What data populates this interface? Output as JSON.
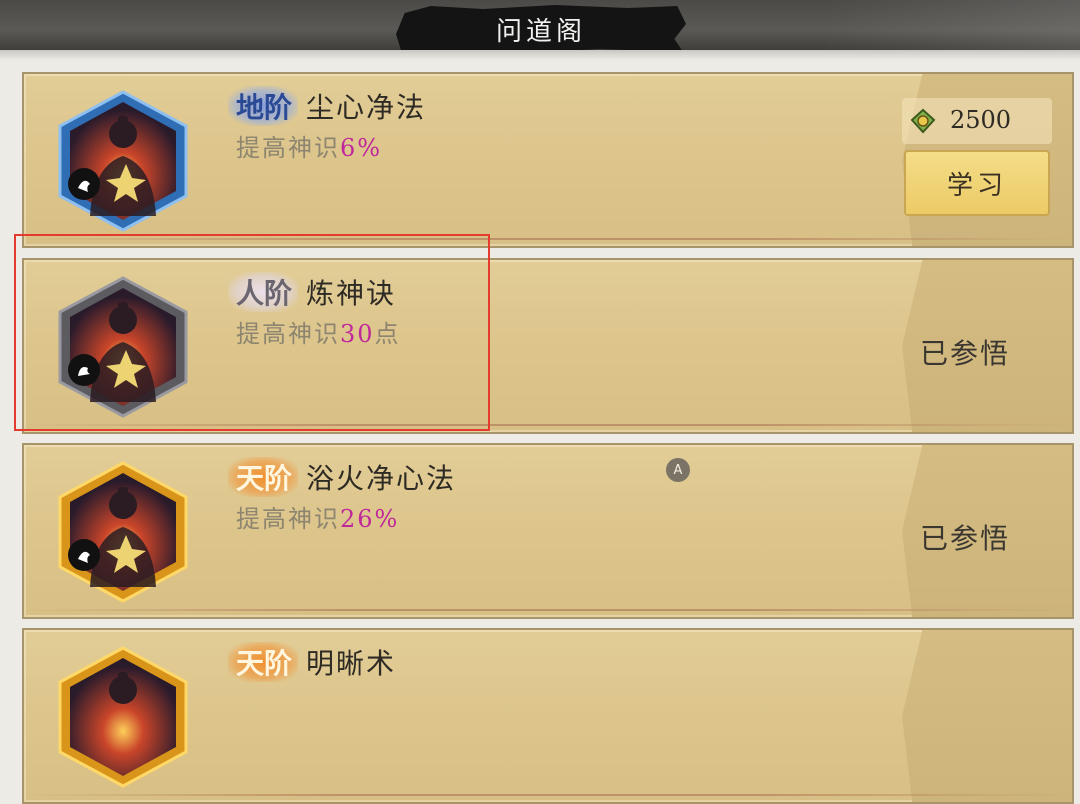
{
  "header": {
    "title": "问道阁"
  },
  "skills": [
    {
      "tier": "地阶",
      "tier_style": "earth",
      "name": "尘心净法",
      "effect_prefix": "提高神识",
      "effect_value": "6%",
      "effect_suffix": "",
      "frame_color": "#3f7fd0",
      "price": "2500",
      "price_icon": "jade-token-icon",
      "action_label": "学习"
    },
    {
      "tier": "人阶",
      "tier_style": "human",
      "name": "炼神诀",
      "effect_prefix": "提高神识",
      "effect_value": "30",
      "effect_suffix": "点",
      "frame_color": "#6f6f73",
      "status": "已参悟"
    },
    {
      "tier": "天阶",
      "tier_style": "heaven",
      "name": "浴火净心法",
      "effect_prefix": "提高神识",
      "effect_value": "26%",
      "effect_suffix": "",
      "frame_color": "#e7a91f",
      "status": "已参悟"
    },
    {
      "tier": "天阶",
      "tier_style": "heaven",
      "name": "明晰术",
      "frame_color": "#e7a91f"
    }
  ],
  "overlay": {
    "marker_label": "A"
  }
}
